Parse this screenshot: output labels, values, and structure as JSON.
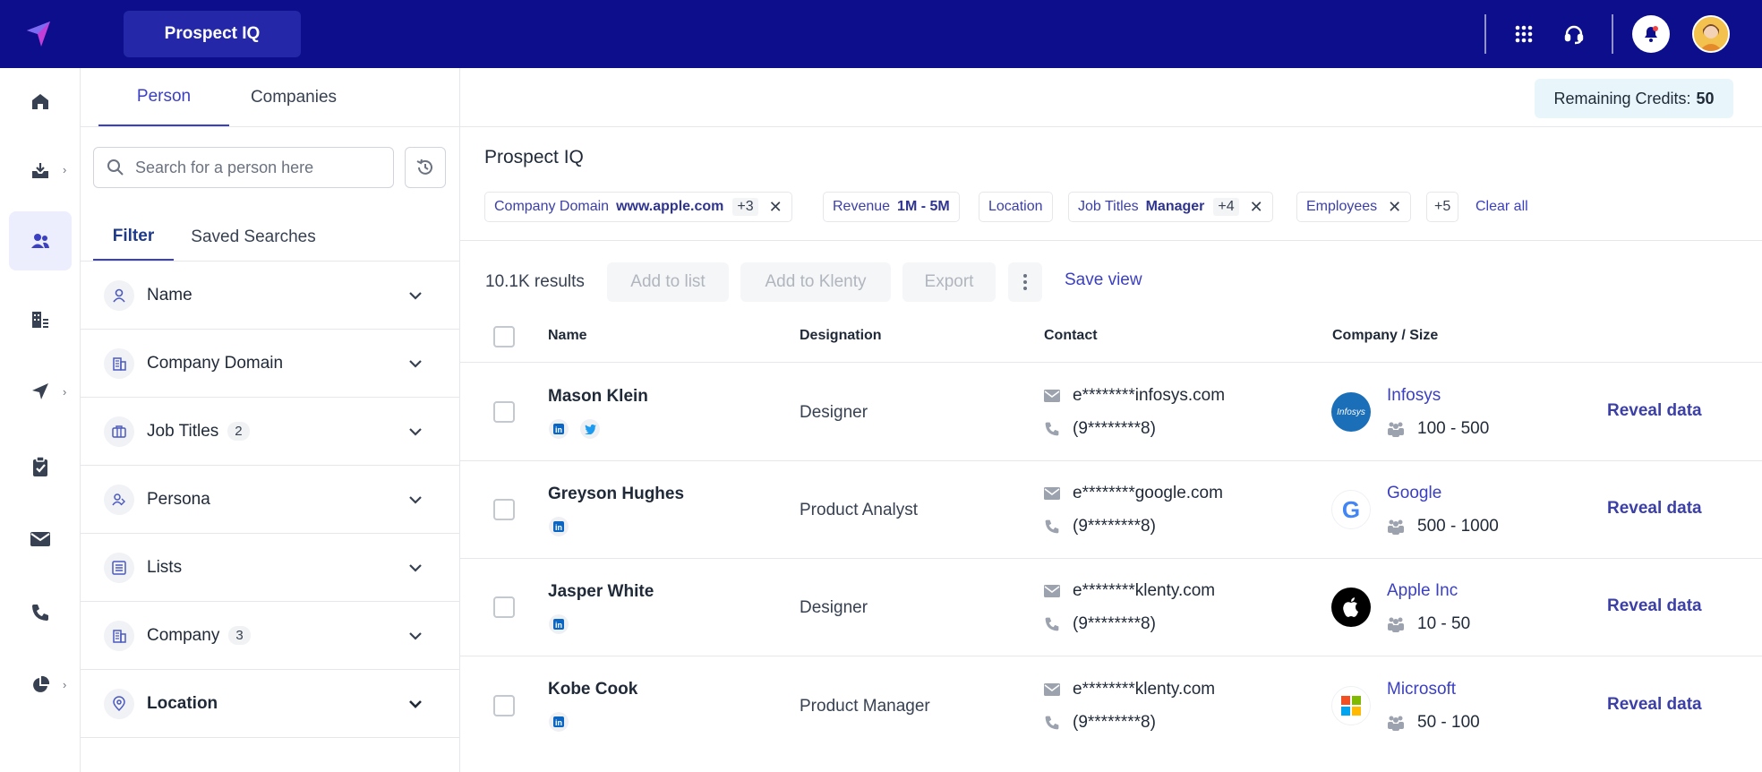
{
  "app": {
    "title": "Prospect IQ"
  },
  "tabs": [
    {
      "label": "Person",
      "active": true
    },
    {
      "label": "Companies",
      "active": false
    }
  ],
  "credits": {
    "label": "Remaining Credits:",
    "value": "50"
  },
  "search": {
    "placeholder": "Search for a person here"
  },
  "subtabs": [
    {
      "label": "Filter",
      "active": true
    },
    {
      "label": "Saved Searches",
      "active": false
    }
  ],
  "filters": [
    {
      "label": "Name",
      "icon": "person-icon",
      "count": ""
    },
    {
      "label": "Company Domain",
      "icon": "building-icon",
      "count": ""
    },
    {
      "label": "Job Titles",
      "icon": "briefcase-icon",
      "count": "2"
    },
    {
      "label": "Persona",
      "icon": "persona-icon",
      "count": ""
    },
    {
      "label": "Lists",
      "icon": "list-icon",
      "count": ""
    },
    {
      "label": "Company",
      "icon": "building-icon",
      "count": "3"
    },
    {
      "label": "Location",
      "icon": "location-pin-icon",
      "count": ""
    }
  ],
  "main": {
    "title": "Prospect IQ",
    "results": "10.1K results",
    "actions": {
      "add_to_list": "Add to list",
      "add_to_klenty": "Add to Klenty",
      "export": "Export",
      "save_view": "Save view"
    },
    "chips": [
      {
        "label": "Company Domain",
        "value": "www.apple.com",
        "more": "+3"
      },
      {
        "label": "Revenue",
        "value": "1M - 5M",
        "more": ""
      },
      {
        "label": "Location",
        "value": "",
        "more": ""
      },
      {
        "label": "Job Titles",
        "value": "Manager",
        "more": "+4"
      },
      {
        "label": "Employees",
        "value": "",
        "more": ""
      }
    ],
    "chips_more": "+5",
    "clear_all": "Clear all",
    "columns": {
      "name": "Name",
      "designation": "Designation",
      "contact": "Contact",
      "company": "Company / Size"
    },
    "rows": [
      {
        "name": "Mason Klein",
        "designation": "Designer",
        "email": "e********infosys.com",
        "phone": "(9********8)",
        "company": "Infosys",
        "size": "100 - 500",
        "reveal": "Reveal data",
        "logo": "Infosys"
      },
      {
        "name": "Greyson Hughes",
        "designation": "Product Analyst",
        "email": "e********google.com",
        "phone": "(9********8)",
        "company": "Google",
        "size": "500 - 1000",
        "reveal": "Reveal data",
        "logo": "G"
      },
      {
        "name": "Jasper White",
        "designation": "Designer",
        "email": "e********klenty.com",
        "phone": "(9********8)",
        "company": "Apple Inc",
        "size": "10 - 50",
        "reveal": "Reveal data",
        "logo": "apple-icon"
      },
      {
        "name": "Kobe Cook",
        "designation": "Product Manager",
        "email": "e********klenty.com",
        "phone": "(9********8)",
        "company": "Microsoft",
        "size": "50 - 100",
        "reveal": "Reveal data",
        "logo": "microsoft-icon"
      }
    ]
  },
  "colors": {
    "topbar": "#0d0e8c",
    "accent": "#3b3fc1",
    "credits_bg": "#e8f6fb"
  }
}
